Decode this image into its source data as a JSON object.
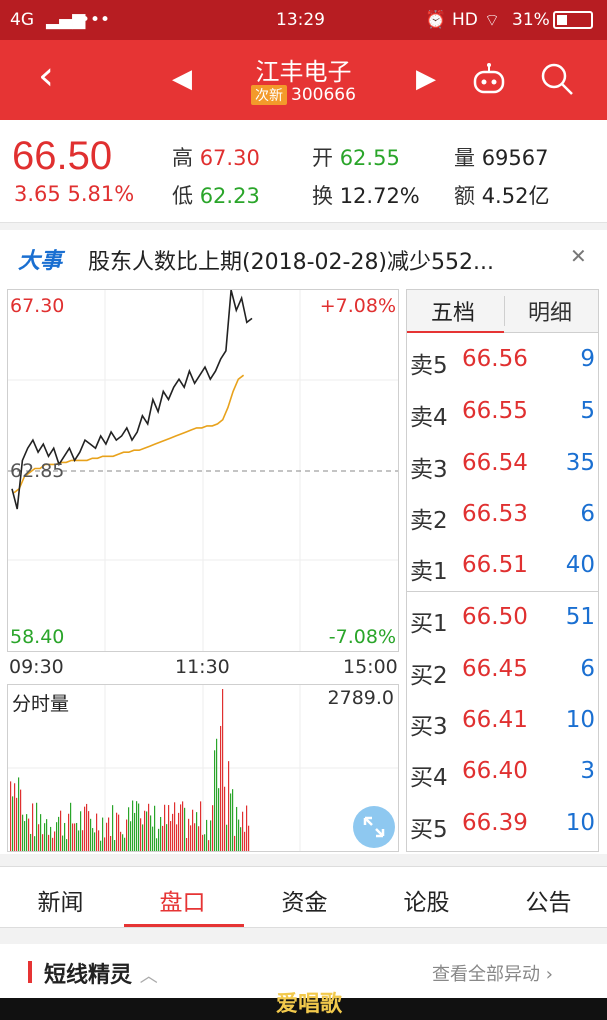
{
  "status": {
    "network": "4G",
    "time": "13:29",
    "hd": "HD",
    "battery": "31%"
  },
  "header": {
    "stock_name": "江丰电子",
    "badge": "次新",
    "code": "300666"
  },
  "quote": {
    "price": "66.50",
    "change": "3.65",
    "change_pct": "5.81%",
    "high_label": "高",
    "high": "67.30",
    "open_label": "开",
    "open": "62.55",
    "volume_label": "量",
    "volume": "69567",
    "low_label": "低",
    "low": "62.23",
    "turnover_label": "换",
    "turnover": "12.72%",
    "amount_label": "额",
    "amount": "4.52亿"
  },
  "news": {
    "tag": "大事",
    "text": "股东人数比上期(2018-02-28)减少552..."
  },
  "chart_data": {
    "type": "line",
    "y_top": "67.30",
    "y_top_pct": "+7.08%",
    "y_mid": "62.85",
    "y_bottom": "58.40",
    "y_bottom_pct": "-7.08%",
    "ylim": [
      58.4,
      67.3
    ],
    "time_labels": [
      "09:30",
      "11:30",
      "15:00"
    ],
    "colors": {
      "price": "#222222",
      "avg": "#e8a21c",
      "vol_up": "#e03030",
      "vol_down": "#2aa52a"
    },
    "price_series": [
      62.4,
      61.9,
      63.1,
      63.4,
      63.6,
      63.3,
      63.5,
      63.2,
      63.4,
      63.0,
      63.2,
      63.4,
      63.1,
      63.3,
      63.6,
      63.5,
      63.4,
      63.7,
      63.5,
      63.8,
      63.6,
      63.7,
      63.9,
      63.6,
      63.8,
      64.2,
      64.0,
      64.6,
      64.3,
      64.8,
      64.6,
      64.9,
      65.1,
      64.9,
      65.3,
      65.0,
      65.2,
      65.4,
      65.1,
      65.3,
      65.6,
      65.8,
      67.3,
      66.8,
      67.1,
      66.5,
      66.6
    ],
    "avg_series": [
      62.3,
      62.4,
      62.7,
      62.8,
      62.9,
      62.9,
      63.0,
      63.0,
      63.0,
      63.05,
      63.05,
      63.1,
      63.1,
      63.1,
      63.1,
      63.15,
      63.15,
      63.2,
      63.2,
      63.2,
      63.25,
      63.3,
      63.3,
      63.35,
      63.35,
      63.4,
      63.45,
      63.5,
      63.55,
      63.6,
      63.65,
      63.7,
      63.75,
      63.8,
      63.85,
      63.9,
      63.9,
      63.95,
      63.95,
      64.0,
      64.1,
      64.4,
      64.8,
      65.1,
      65.2
    ],
    "volume_label": "分时量",
    "volume_max": "2789.0"
  },
  "orderbook": {
    "tabs": [
      "五档",
      "明细"
    ],
    "asks": [
      {
        "side": "卖5",
        "price": "66.56",
        "vol": "9"
      },
      {
        "side": "卖4",
        "price": "66.55",
        "vol": "5"
      },
      {
        "side": "卖3",
        "price": "66.54",
        "vol": "35"
      },
      {
        "side": "卖2",
        "price": "66.53",
        "vol": "6"
      },
      {
        "side": "卖1",
        "price": "66.51",
        "vol": "40"
      }
    ],
    "bids": [
      {
        "side": "买1",
        "price": "66.50",
        "vol": "51"
      },
      {
        "side": "买2",
        "price": "66.45",
        "vol": "6"
      },
      {
        "side": "买3",
        "price": "66.41",
        "vol": "10"
      },
      {
        "side": "买4",
        "price": "66.40",
        "vol": "3"
      },
      {
        "side": "买5",
        "price": "66.39",
        "vol": "10"
      }
    ]
  },
  "tabs": [
    "新闻",
    "盘口",
    "资金",
    "论股",
    "公告"
  ],
  "section": {
    "title": "短线精灵",
    "more": "查看全部异动"
  },
  "watermark": "爱唱歌"
}
